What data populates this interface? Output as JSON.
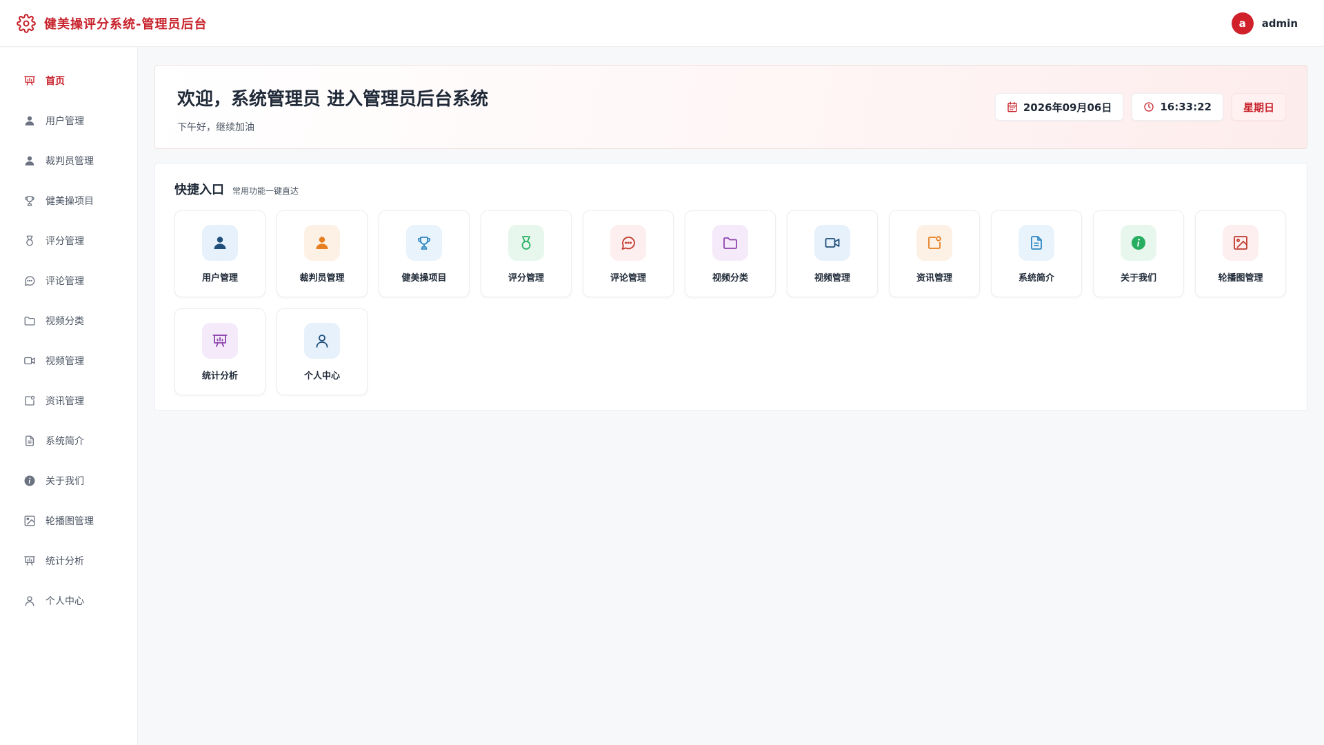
{
  "header": {
    "brand_icon": "gear-icon",
    "title": "健美操评分系统-管理员后台",
    "avatar_letter": "a",
    "username": "admin",
    "accent": "#c8232c"
  },
  "sidebar": {
    "items": [
      {
        "label": "首页",
        "icon": "presentation-chart-icon",
        "active": true
      },
      {
        "label": "用户管理",
        "icon": "user-icon"
      },
      {
        "label": "裁判员管理",
        "icon": "user-icon"
      },
      {
        "label": "健美操项目",
        "icon": "trophy-icon"
      },
      {
        "label": "评分管理",
        "icon": "medal-icon"
      },
      {
        "label": "评论管理",
        "icon": "chat-bubble-icon"
      },
      {
        "label": "视频分类",
        "icon": "folder-icon"
      },
      {
        "label": "视频管理",
        "icon": "video-camera-icon"
      },
      {
        "label": "资讯管理",
        "icon": "news-icon"
      },
      {
        "label": "系统简介",
        "icon": "document-icon"
      },
      {
        "label": "关于我们",
        "icon": "info-icon"
      },
      {
        "label": "轮播图管理",
        "icon": "image-icon"
      },
      {
        "label": "统计分析",
        "icon": "presentation-chart-icon"
      },
      {
        "label": "个人中心",
        "icon": "user-outline-icon"
      }
    ]
  },
  "welcome": {
    "title": "欢迎，系统管理员 进入管理员后台系统",
    "subtitle": "下午好，继续加油",
    "date": "2026年09月06日",
    "time": "16:33:22",
    "weekday": "星期日"
  },
  "quick": {
    "title": "快捷入口",
    "subtitle": "常用功能一键直达",
    "items": [
      {
        "label": "用户管理",
        "icon": "user-icon",
        "bg": "#e6f1fb",
        "fg": "#1f4e79"
      },
      {
        "label": "裁判员管理",
        "icon": "user-icon",
        "bg": "#fdf0e4",
        "fg": "#e67e22"
      },
      {
        "label": "健美操项目",
        "icon": "trophy-icon",
        "bg": "#e9f3fb",
        "fg": "#2e86c1"
      },
      {
        "label": "评分管理",
        "icon": "medal-icon",
        "bg": "#e8f7ee",
        "fg": "#27ae60"
      },
      {
        "label": "评论管理",
        "icon": "chat-bubble-icon",
        "bg": "#fdeef0",
        "fg": "#c0392b"
      },
      {
        "label": "视频分类",
        "icon": "folder-icon",
        "bg": "#f4eafa",
        "fg": "#8e44ad"
      },
      {
        "label": "视频管理",
        "icon": "video-camera-icon",
        "bg": "#e6f1fb",
        "fg": "#1f4e79"
      },
      {
        "label": "资讯管理",
        "icon": "news-icon",
        "bg": "#fdf0e4",
        "fg": "#e67e22"
      },
      {
        "label": "系统简介",
        "icon": "document-icon",
        "bg": "#e9f3fb",
        "fg": "#2e86c1"
      },
      {
        "label": "关于我们",
        "icon": "info-icon",
        "bg": "#e8f7ee",
        "fg": "#27ae60"
      },
      {
        "label": "轮播图管理",
        "icon": "image-icon",
        "bg": "#fdeef0",
        "fg": "#c0392b"
      },
      {
        "label": "统计分析",
        "icon": "presentation-chart-icon",
        "bg": "#f4eafa",
        "fg": "#8e44ad"
      },
      {
        "label": "个人中心",
        "icon": "user-outline-icon",
        "bg": "#e6f1fb",
        "fg": "#1f4e79"
      }
    ]
  }
}
